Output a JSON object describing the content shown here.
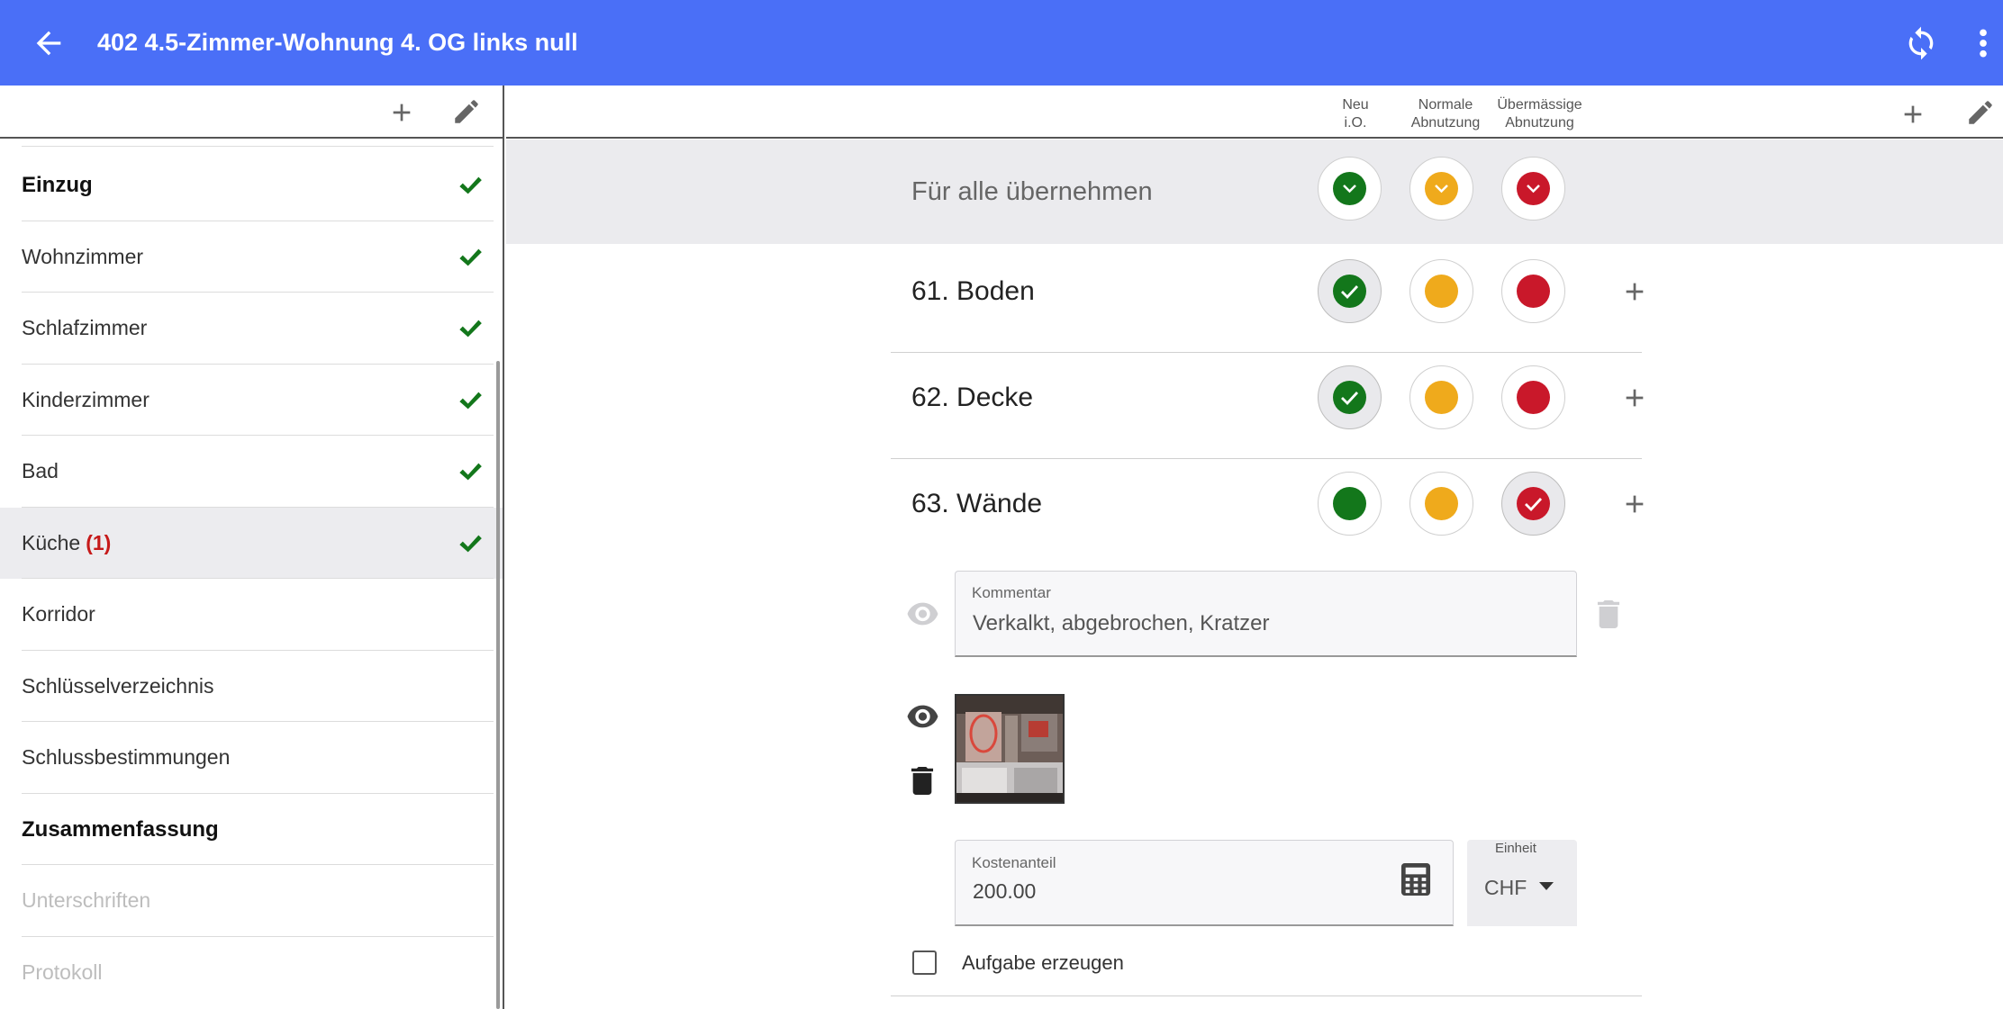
{
  "appbar": {
    "title": "402 4.5-Zimmer-Wohnung 4. OG links null",
    "back_icon": "arrow-left-icon",
    "sync_icon": "sync-icon",
    "menu_icon": "more-vertical-icon",
    "color": "#4a6ff7"
  },
  "sidebar": {
    "items": [
      {
        "label": "Einzug",
        "bold": true,
        "checked": true
      },
      {
        "label": "Wohnzimmer",
        "checked": true
      },
      {
        "label": "Schlafzimmer",
        "checked": true
      },
      {
        "label": "Kinderzimmer",
        "checked": true
      },
      {
        "label": "Bad",
        "checked": true
      },
      {
        "label": "Küche",
        "badge": "(1)",
        "checked": true,
        "active": true
      },
      {
        "label": "Korridor"
      },
      {
        "label": "Schlüsselverzeichnis"
      },
      {
        "label": "Schlussbestimmungen"
      },
      {
        "label": "Zusammenfassung",
        "bold": true
      },
      {
        "label": "Unterschriften",
        "disabled": true
      },
      {
        "label": "Protokoll",
        "disabled": true
      }
    ]
  },
  "columns": {
    "neu_line1": "Neu",
    "neu_line2": "i.O.",
    "normal_line1": "Normale",
    "normal_line2": "Abnutzung",
    "excess_line1": "Übermässige",
    "excess_line2": "Abnutzung"
  },
  "apply_all": {
    "label": "Für alle übernehmen"
  },
  "rows": [
    {
      "label": "61. Boden",
      "selected": "green"
    },
    {
      "label": "62. Decke",
      "selected": "green"
    },
    {
      "label": "63. Wände",
      "selected": "red"
    }
  ],
  "comment": {
    "caption": "Kommentar",
    "value": "Verkalkt, abgebrochen, Kratzer"
  },
  "cost": {
    "caption": "Kostenanteil",
    "value": "200.00"
  },
  "unit": {
    "caption": "Einheit",
    "value": "CHF"
  },
  "task": {
    "label": "Aufgabe erzeugen",
    "checked": false
  },
  "colors": {
    "green": "#13771b",
    "orange": "#efaa1c",
    "red": "#c9182a",
    "check": "#13771b"
  }
}
